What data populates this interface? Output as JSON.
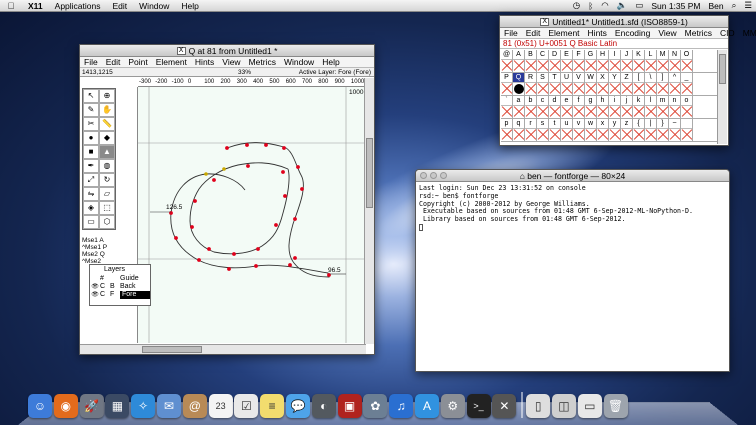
{
  "menubar": {
    "apple": "",
    "app_name": "X11",
    "items": [
      "Applications",
      "Edit",
      "Window",
      "Help"
    ],
    "clock": "Sun 1:35 PM",
    "user": "Ben",
    "battery": "",
    "icons": [
      "time-machine-icon",
      "bluetooth-icon",
      "wifi-icon",
      "volume-icon",
      "spotlight-icon",
      "notification-center-icon"
    ]
  },
  "glyph_window": {
    "title": "Q at 81 from Untitled1 *",
    "menu": [
      "File",
      "Edit",
      "Point",
      "Element",
      "Hints",
      "View",
      "Metrics",
      "Window",
      "Help"
    ],
    "coords": "1413,1215",
    "zoom": "33%",
    "active_layer": "Active Layer: Fore (Fore)",
    "ruler_ticks": [
      "-300",
      "-200",
      "-100",
      "0",
      "100",
      "200",
      "300",
      "400",
      "500",
      "600",
      "700",
      "800",
      "900",
      "1000"
    ],
    "em_label": "1000",
    "measure_left": "126.5",
    "measure_right": "96.5",
    "tools": [
      [
        "pointer-tool",
        "magnify-tool"
      ],
      [
        "freehand-tool",
        "scroll-hand-tool"
      ],
      [
        "knife-tool",
        "ruler-tool"
      ],
      [
        "curve-point-tool",
        "hv-curve-tool"
      ],
      [
        "corner-point-tool",
        "tangent-point-tool"
      ],
      [
        "pen-tool",
        "spiro-tool"
      ],
      [
        "scale-tool",
        "rotate-tool"
      ],
      [
        "flip-tool",
        "skew-tool"
      ],
      [
        "3d-rotate-tool",
        "perspective-tool"
      ],
      [
        "rectangle-tool",
        "polygon-tool"
      ]
    ],
    "mouse_labels": [
      "Mse1",
      "^Mse1",
      "Mse2",
      "^Mse2"
    ],
    "mouse_marks": [
      "A",
      "P",
      "Q"
    ],
    "layers": {
      "title": "Layers",
      "rows": [
        {
          "eye": "",
          "mark": "#",
          "type": "",
          "name": "Guide"
        },
        {
          "eye": "👁",
          "mark": "C",
          "type": "B",
          "name": "Back"
        },
        {
          "eye": "👁",
          "mark": "C",
          "type": "F",
          "name": "Fore"
        }
      ]
    }
  },
  "font_window": {
    "title": "Untitled1*  Untitled1.sfd (ISO8859-1)",
    "menu": [
      "File",
      "Edit",
      "Element",
      "Hints",
      "Encoding",
      "View",
      "Metrics",
      "CID",
      "MM"
    ],
    "header": "81  (0x51)  U+0051  Q  Basic Latin",
    "rows": [
      [
        "@",
        "A",
        "B",
        "C",
        "D",
        "E",
        "F",
        "G",
        "H",
        "I",
        "J",
        "K",
        "L",
        "M",
        "N",
        "O"
      ],
      [
        "P",
        "Q",
        "R",
        "S",
        "T",
        "U",
        "V",
        "W",
        "X",
        "Y",
        "Z",
        "[",
        "\\",
        "]",
        "^",
        "_"
      ],
      [
        "`",
        "a",
        "b",
        "c",
        "d",
        "e",
        "f",
        "g",
        "h",
        "i",
        "j",
        "k",
        "l",
        "m",
        "n",
        "o"
      ],
      [
        "p",
        "q",
        "r",
        "s",
        "t",
        "u",
        "v",
        "w",
        "x",
        "y",
        "z",
        "{",
        "|",
        "}",
        "~",
        ""
      ]
    ],
    "selected": "Q"
  },
  "terminal": {
    "title": "ben — fontforge — 80×24",
    "lines": [
      "Last login: Sun Dec 23 13:31:52 on console",
      "rsd:~ ben$ fontforge",
      "Copyright (c) 2000-2012 by George Williams.",
      " Executable based on sources from 01:48 GMT 6-Sep-2012-ML-NoPython-D.",
      " Library based on sources from 01:48 GMT 6-Sep-2012."
    ]
  },
  "dock": {
    "apps": [
      {
        "name": "finder-icon",
        "color": "#3d7bd9",
        "glyph": "☺"
      },
      {
        "name": "firefox-icon",
        "color": "#e36b1c",
        "glyph": "◉"
      },
      {
        "name": "launchpad-icon",
        "color": "#707784",
        "glyph": "🚀"
      },
      {
        "name": "mission-control-icon",
        "color": "#3b4a64",
        "glyph": "▦"
      },
      {
        "name": "safari-icon",
        "color": "#2e8ad8",
        "glyph": "✧"
      },
      {
        "name": "mail-icon",
        "color": "#5f8fd0",
        "glyph": "✉"
      },
      {
        "name": "contacts-icon",
        "color": "#b88a56",
        "glyph": "@"
      },
      {
        "name": "calendar-icon",
        "color": "#f4f4f4",
        "glyph": "23"
      },
      {
        "name": "reminders-icon",
        "color": "#e9e9e9",
        "glyph": "☑"
      },
      {
        "name": "notes-icon",
        "color": "#f2dc6e",
        "glyph": "≡"
      },
      {
        "name": "messages-icon",
        "color": "#4ea4ea",
        "glyph": "💬"
      },
      {
        "name": "facetime-icon",
        "color": "#53595f",
        "glyph": "◐"
      },
      {
        "name": "photo-booth-icon",
        "color": "#b0231e",
        "glyph": "▣"
      },
      {
        "name": "iphoto-icon",
        "color": "#6c7f94",
        "glyph": "✿"
      },
      {
        "name": "itunes-icon",
        "color": "#2a6fd1",
        "glyph": "♫"
      },
      {
        "name": "app-store-icon",
        "color": "#3192e0",
        "glyph": "A"
      },
      {
        "name": "system-preferences-icon",
        "color": "#8b8f96",
        "glyph": "⚙"
      },
      {
        "name": "terminal-icon",
        "color": "#222",
        "glyph": ">_"
      },
      {
        "name": "x11-icon",
        "color": "#555",
        "glyph": "✕"
      },
      {
        "name": "fontforge-doc-icon",
        "color": "#dedede",
        "glyph": "▯"
      },
      {
        "name": "preview-doc-icon",
        "color": "#cfcfcf",
        "glyph": "◫"
      },
      {
        "name": "downloads-stack-icon",
        "color": "#e8e8e8",
        "glyph": "▭"
      },
      {
        "name": "trash-icon",
        "color": "#9da4ad",
        "glyph": "🗑"
      }
    ]
  }
}
